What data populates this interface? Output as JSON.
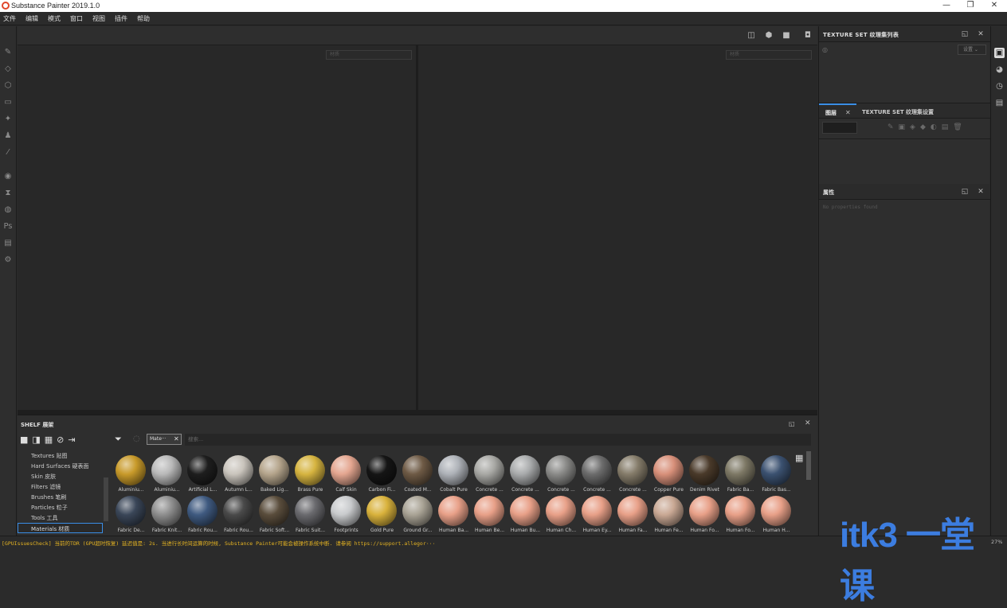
{
  "window": {
    "title": "Substance Painter 2019.1.0",
    "minimize": "—",
    "maximize": "❐",
    "close": "✕"
  },
  "menu": [
    "文件",
    "编辑",
    "模式",
    "窗口",
    "视图",
    "插件",
    "帮助"
  ],
  "viewport": {
    "left_material_placeholder": "材质",
    "right_material_placeholder": "材质"
  },
  "texture_set_list": {
    "title": "TEXTURE SET 纹理集列表",
    "settings_label": "设置 ⌄"
  },
  "layers": {
    "tab_layers": "图层",
    "tab_texture_set_settings": "TEXTURE SET 纹理集设置"
  },
  "properties": {
    "title": "属性",
    "empty_text": "No properties found"
  },
  "shelf": {
    "title": "SHELF 展架",
    "filter_tag": "Mate···",
    "search_placeholder": "搜索...",
    "categories": [
      "Textures 贴图",
      "Hard Surfaces 硬表面",
      "Skin 皮肤",
      "Filters 滤镜",
      "Brushes 笔刷",
      "Particles 粒子",
      "Tools 工具",
      "Materials 材质"
    ],
    "row1": [
      {
        "label": "Aluminiu...",
        "color": "#c89a2a"
      },
      {
        "label": "Aluminiu...",
        "color": "#b9b9b9"
      },
      {
        "label": "Artificial L...",
        "color": "#1e1e1e"
      },
      {
        "label": "Autumn L...",
        "color": "#c9c4bc"
      },
      {
        "label": "Baked Lig...",
        "color": "#b5a58c"
      },
      {
        "label": "Brass Pure",
        "color": "#d6b440"
      },
      {
        "label": "Calf Skin",
        "color": "#e4a690"
      },
      {
        "label": "Carbon Fi...",
        "color": "#151515"
      },
      {
        "label": "Coated M...",
        "color": "#6e5a45"
      },
      {
        "label": "Cobalt Pure",
        "color": "#aeb2b8"
      },
      {
        "label": "Concrete ...",
        "color": "#a8a8a4"
      },
      {
        "label": "Concrete ...",
        "color": "#a9abac"
      },
      {
        "label": "Concrete ...",
        "color": "#8a8a88"
      },
      {
        "label": "Concrete ...",
        "color": "#6c6c6c"
      },
      {
        "label": "Concrete ...",
        "color": "#857c6a"
      },
      {
        "label": "Copper Pure",
        "color": "#d8907a"
      },
      {
        "label": "Denim Rivet",
        "color": "#4a3a2a"
      },
      {
        "label": "Fabric Ba...",
        "color": "#7d7865"
      },
      {
        "label": "Fabric Bas...",
        "color": "#3b5170"
      }
    ],
    "row2": [
      {
        "label": "Fabric De...",
        "color": "#3a4658"
      },
      {
        "label": "Fabric Knit...",
        "color": "#8e8e8e"
      },
      {
        "label": "Fabric Rou...",
        "color": "#3f5a80"
      },
      {
        "label": "Fabric Rou...",
        "color": "#4a4a4a"
      },
      {
        "label": "Fabric Soft...",
        "color": "#5a4d3c"
      },
      {
        "label": "Fabric Suit...",
        "color": "#6a6a6e"
      },
      {
        "label": "Footprints",
        "color": "#c8cacc"
      },
      {
        "label": "Gold Pure",
        "color": "#d9b23c"
      },
      {
        "label": "Ground Gr...",
        "color": "#a9a395"
      },
      {
        "label": "Human Ba...",
        "color": "#e8a088"
      },
      {
        "label": "Human Be...",
        "color": "#e8a088"
      },
      {
        "label": "Human Bu...",
        "color": "#e8a088"
      },
      {
        "label": "Human Ch...",
        "color": "#e8a088"
      },
      {
        "label": "Human Ey...",
        "color": "#e8a088"
      },
      {
        "label": "Human Fa...",
        "color": "#e8a088"
      },
      {
        "label": "Human Fe...",
        "color": "#c9a894"
      },
      {
        "label": "Human Fo...",
        "color": "#e8a088"
      },
      {
        "label": "Human Fo...",
        "color": "#e8a088"
      },
      {
        "label": "Human H...",
        "color": "#e8a088"
      }
    ]
  },
  "status": {
    "message": "[GPUIssuesCheck] 当前的TDR (GPU超时恢复) 延迟值是: 2s. 当进行长时间运算的时候, Substance Painter可能会被操作系统中断. 请参阅 https://support.allegor···",
    "zoom": "27%"
  },
  "watermark": "itk3 一堂课"
}
